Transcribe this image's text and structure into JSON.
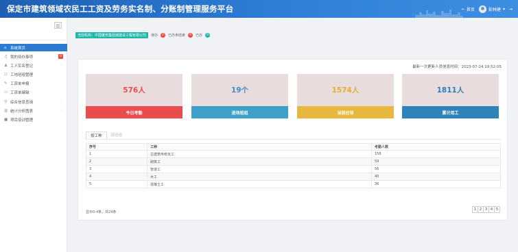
{
  "header": {
    "title": "保定市建筑领域农民工工资及劳务实名制、分账制管理服务平台",
    "home_label": "首页",
    "user_name": "彭林建"
  },
  "sidebar": {
    "items": [
      {
        "label": "系统首页",
        "icon": "home-icon",
        "glyph": "⌂",
        "active": true
      },
      {
        "label": "我的待办事项",
        "icon": "bell-icon",
        "glyph": "♫",
        "badge": "0"
      },
      {
        "label": "工人实名登记",
        "icon": "user-icon",
        "glyph": "♟",
        "chevron": true
      },
      {
        "label": "工地班组管理",
        "icon": "team-icon",
        "glyph": "☷"
      },
      {
        "label": "工资单申报",
        "icon": "edit-icon",
        "glyph": "✎"
      },
      {
        "label": "工资单编辑",
        "icon": "card-icon",
        "glyph": "▭"
      },
      {
        "label": "综合信息查询",
        "icon": "search-icon",
        "glyph": "⚲",
        "chevron": true
      },
      {
        "label": "统计分析图表",
        "icon": "chart-icon",
        "glyph": "▥",
        "chevron": true
      },
      {
        "label": "项目培训管理",
        "icon": "video-icon",
        "glyph": "■"
      }
    ]
  },
  "infobar": {
    "org": "当前机构：中国雄安集团城建设工程有限公司",
    "status1_label": "待办",
    "status1_count": "0",
    "status2_label": "已办未结束",
    "status2_count": "0",
    "status3_label": "已办",
    "status3_count": "0"
  },
  "update_time": "最新一次更新人员信息时间：2023-07-24 19:52:05",
  "cards": [
    {
      "value": "576人",
      "label": "今日考勤",
      "color": "#e94b4f",
      "value_color": "#e94b4f"
    },
    {
      "value": "19个",
      "label": "进场班组",
      "color": "#3e9fc9",
      "value_color": "#3e8fc4"
    },
    {
      "value": "1574人",
      "label": "当前在场",
      "color": "#e8b73e",
      "value_color": "#e3b030"
    },
    {
      "value": "1811人",
      "label": "累计用工",
      "color": "#2f82ba",
      "value_color": "#2f7fb8"
    }
  ],
  "tabs": [
    "按工种",
    "按班组"
  ],
  "table": {
    "headers": [
      "序号",
      "工种",
      "考勤人数"
    ],
    "rows": [
      [
        "1",
        "古建筑传统瓦工",
        "158"
      ],
      [
        "2",
        "砌筑工",
        "59"
      ],
      [
        "3",
        "管道工",
        "56"
      ],
      [
        "4",
        "木工",
        "40"
      ],
      [
        "5",
        "混凝土工",
        "36"
      ]
    ]
  },
  "summary": "显示0-4条，共24条",
  "pages": [
    "1",
    "2",
    "3",
    "4",
    "5"
  ]
}
